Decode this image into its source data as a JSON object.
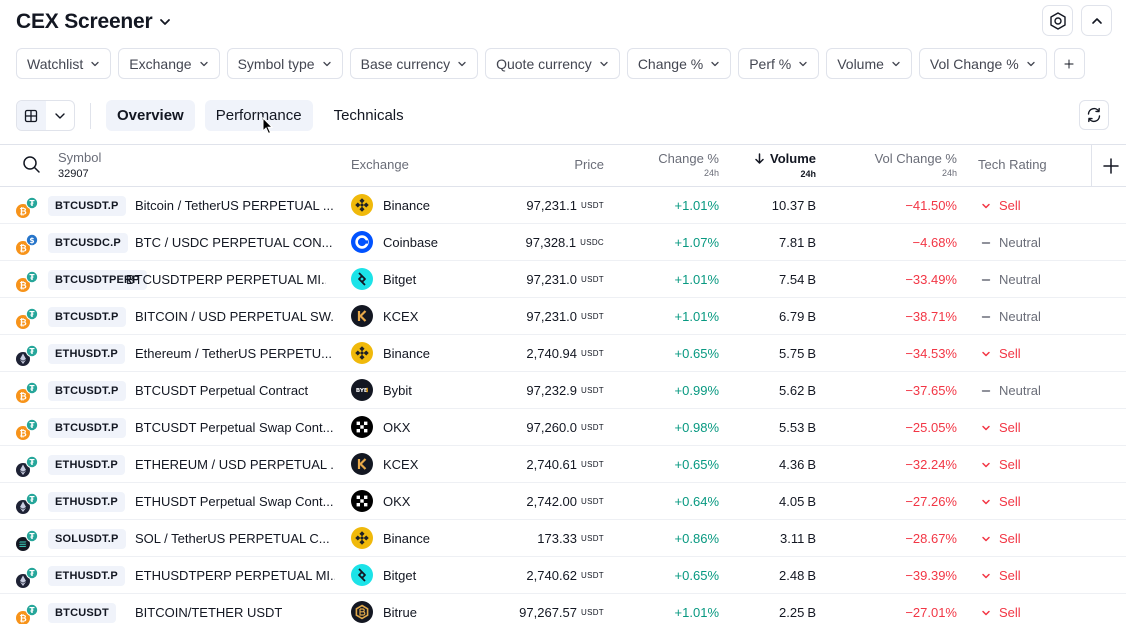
{
  "app": {
    "title": "CEX Screener"
  },
  "filters": [
    "Watchlist",
    "Exchange",
    "Symbol type",
    "Base currency",
    "Quote currency",
    "Change %",
    "Perf %",
    "Volume",
    "Vol Change %"
  ],
  "tabs": [
    {
      "label": "Overview",
      "active": true
    },
    {
      "label": "Performance",
      "active": false
    },
    {
      "label": "Technicals",
      "active": false
    }
  ],
  "table": {
    "headers": {
      "symbol": "Symbol",
      "symbol_count": "32907",
      "exchange": "Exchange",
      "price": "Price",
      "change": "Change %",
      "change_sub": "24h",
      "volume": "Volume",
      "volume_sub": "24h",
      "vol_change": "Vol Change %",
      "vol_change_sub": "24h",
      "tech_rating": "Tech Rating"
    },
    "rows": [
      {
        "coin": "btc",
        "ticker": "BTCUSDT.P",
        "desc": "Bitcoin / TetherUS PERPETUAL ...",
        "exchange": "Binance",
        "ex": "binance",
        "price": "97,231.1",
        "unit": "USDT",
        "change": "+1.01%",
        "volume": "10.37",
        "vol_unit": "B",
        "vol_change": "−41.50%",
        "rating": "Sell"
      },
      {
        "coin": "btc2",
        "ticker": "BTCUSDC.P",
        "desc": "BTC / USDC PERPETUAL CON...",
        "exchange": "Coinbase",
        "ex": "coinbase",
        "price": "97,328.1",
        "unit": "USDC",
        "change": "+1.07%",
        "volume": "7.81",
        "vol_unit": "B",
        "vol_change": "−4.68%",
        "rating": "Neutral"
      },
      {
        "coin": "btc",
        "ticker": "BTCUSDTPERP",
        "desc": "BTCUSDTPERP PERPETUAL MI...",
        "exchange": "Bitget",
        "ex": "bitget",
        "price": "97,231.0",
        "unit": "USDT",
        "change": "+1.01%",
        "volume": "7.54",
        "vol_unit": "B",
        "vol_change": "−33.49%",
        "rating": "Neutral"
      },
      {
        "coin": "btc",
        "ticker": "BTCUSDT.P",
        "desc": "BITCOIN / USD PERPETUAL SW...",
        "exchange": "KCEX",
        "ex": "kcex",
        "price": "97,231.0",
        "unit": "USDT",
        "change": "+1.01%",
        "volume": "6.79",
        "vol_unit": "B",
        "vol_change": "−38.71%",
        "rating": "Neutral"
      },
      {
        "coin": "eth",
        "ticker": "ETHUSDT.P",
        "desc": "Ethereum / TetherUS PERPETU...",
        "exchange": "Binance",
        "ex": "binance",
        "price": "2,740.94",
        "unit": "USDT",
        "change": "+0.65%",
        "volume": "5.75",
        "vol_unit": "B",
        "vol_change": "−34.53%",
        "rating": "Sell"
      },
      {
        "coin": "btc",
        "ticker": "BTCUSDT.P",
        "desc": "BTCUSDT Perpetual Contract",
        "exchange": "Bybit",
        "ex": "bybit",
        "price": "97,232.9",
        "unit": "USDT",
        "change": "+0.99%",
        "volume": "5.62",
        "vol_unit": "B",
        "vol_change": "−37.65%",
        "rating": "Neutral"
      },
      {
        "coin": "btc",
        "ticker": "BTCUSDT.P",
        "desc": "BTCUSDT Perpetual Swap Cont...",
        "exchange": "OKX",
        "ex": "okx",
        "price": "97,260.0",
        "unit": "USDT",
        "change": "+0.98%",
        "volume": "5.53",
        "vol_unit": "B",
        "vol_change": "−25.05%",
        "rating": "Sell"
      },
      {
        "coin": "eth",
        "ticker": "ETHUSDT.P",
        "desc": "ETHEREUM / USD PERPETUAL ...",
        "exchange": "KCEX",
        "ex": "kcex",
        "price": "2,740.61",
        "unit": "USDT",
        "change": "+0.65%",
        "volume": "4.36",
        "vol_unit": "B",
        "vol_change": "−32.24%",
        "rating": "Sell"
      },
      {
        "coin": "eth",
        "ticker": "ETHUSDT.P",
        "desc": "ETHUSDT Perpetual Swap Cont...",
        "exchange": "OKX",
        "ex": "okx",
        "price": "2,742.00",
        "unit": "USDT",
        "change": "+0.64%",
        "volume": "4.05",
        "vol_unit": "B",
        "vol_change": "−27.26%",
        "rating": "Sell"
      },
      {
        "coin": "sol",
        "ticker": "SOLUSDT.P",
        "desc": "SOL / TetherUS PERPETUAL C...",
        "exchange": "Binance",
        "ex": "binance",
        "price": "173.33",
        "unit": "USDT",
        "change": "+0.86%",
        "volume": "3.11",
        "vol_unit": "B",
        "vol_change": "−28.67%",
        "rating": "Sell"
      },
      {
        "coin": "eth",
        "ticker": "ETHUSDT.P",
        "desc": "ETHUSDTPERP PERPETUAL MI...",
        "exchange": "Bitget",
        "ex": "bitget",
        "price": "2,740.62",
        "unit": "USDT",
        "change": "+0.65%",
        "volume": "2.48",
        "vol_unit": "B",
        "vol_change": "−39.39%",
        "rating": "Sell"
      },
      {
        "coin": "btc",
        "ticker": "BTCUSDT",
        "desc": "BITCOIN/TETHER USDT",
        "exchange": "Bitrue",
        "ex": "bitrue",
        "price": "97,267.57",
        "unit": "USDT",
        "change": "+1.01%",
        "volume": "2.25",
        "vol_unit": "B",
        "vol_change": "−27.01%",
        "rating": "Sell"
      }
    ]
  },
  "colors": {
    "positive": "#089981",
    "negative": "#f23645",
    "neutral": "#6a6d78",
    "border": "#e0e3eb",
    "chip_bg": "#f0f3fa"
  },
  "icons": [
    "chevron-down-icon",
    "settings-icon",
    "chevron-up-icon",
    "plus-icon",
    "grid-icon",
    "refresh-icon",
    "search-icon",
    "sort-arrow-down-icon"
  ]
}
